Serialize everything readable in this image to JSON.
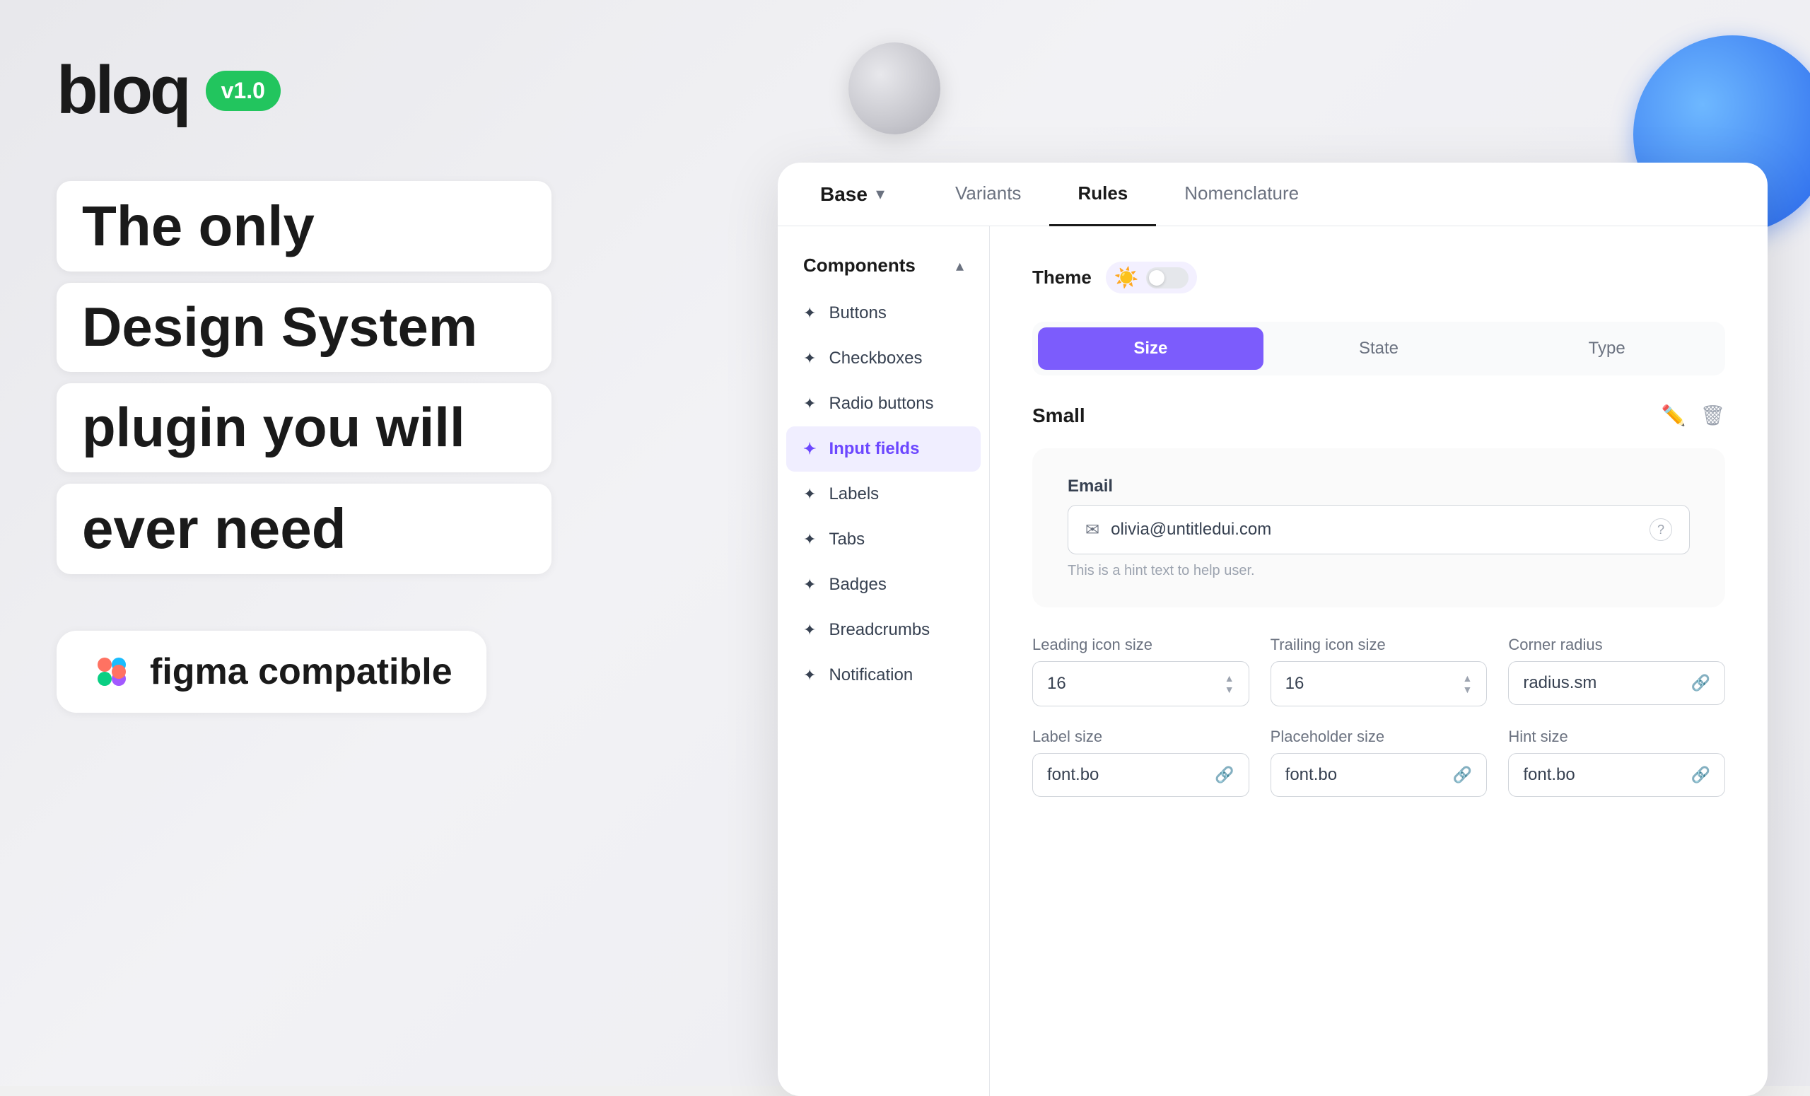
{
  "background": {
    "color": "#f0f0f2"
  },
  "logo": {
    "text": "bloq",
    "version": "v1.0"
  },
  "headline": {
    "line1": "The only",
    "line2": "Design System",
    "line3": "plugin you will",
    "line4": "ever need"
  },
  "figma_badge": {
    "text": "figma compatible"
  },
  "app": {
    "nav": {
      "base_label": "Base",
      "tabs": [
        "Variants",
        "Rules",
        "Nomenclature"
      ],
      "active_tab": "Rules"
    },
    "sidebar": {
      "section_title": "Components",
      "items": [
        "Buttons",
        "Checkboxes",
        "Radio buttons",
        "Input fields",
        "Labels",
        "Tabs",
        "Badges",
        "Breadcrumbs",
        "Notification"
      ],
      "active_item": "Input fields"
    },
    "theme": {
      "label": "Theme",
      "mode": "light"
    },
    "filter_tabs": {
      "tabs": [
        "Size",
        "State",
        "Type"
      ],
      "active": "Size"
    },
    "size_section": {
      "title": "Small",
      "email_preview": {
        "label": "Email",
        "placeholder": "olivia@untitledui.com",
        "hint": "This is a hint text to help user."
      }
    },
    "settings": {
      "leading_icon_size": {
        "label": "Leading icon size",
        "value": "16"
      },
      "trailing_icon_size": {
        "label": "Trailing icon size",
        "value": "16"
      },
      "corner_radius": {
        "label": "Corner radius",
        "value": "radius.sm"
      },
      "label_size": {
        "label": "Label size",
        "value": "font.bo"
      },
      "placeholder_size": {
        "label": "Placeholder size",
        "value": "font.bo"
      },
      "hint_size": {
        "label": "Hint size",
        "value": "font.bo"
      }
    }
  }
}
